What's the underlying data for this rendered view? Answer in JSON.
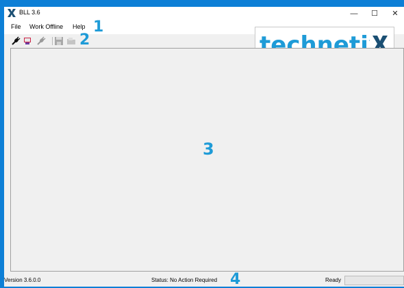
{
  "window": {
    "title": "BLL 3.6",
    "controls": {
      "minimize": "—",
      "maximize": "☐",
      "close": "✕"
    }
  },
  "menu": {
    "items": [
      {
        "label": "File"
      },
      {
        "label": "Work Offline"
      },
      {
        "label": "Help"
      }
    ]
  },
  "toolbar": {
    "icons": [
      "connect-icon",
      "device-icon",
      "disconnect-icon",
      "save-icon",
      "folder-icon"
    ]
  },
  "logo": {
    "text": "technetix",
    "color": "#1e9bd7",
    "x_color": "#1b4f73"
  },
  "annotations": {
    "n1": "1",
    "n2": "2",
    "n3": "3",
    "n4": "4"
  },
  "status": {
    "version": "Version 3.6.0.0",
    "message": "Status: No Action Required",
    "state": "Ready"
  },
  "colors": {
    "accent": "#1e9bd7",
    "border": "#0d7fd6"
  }
}
